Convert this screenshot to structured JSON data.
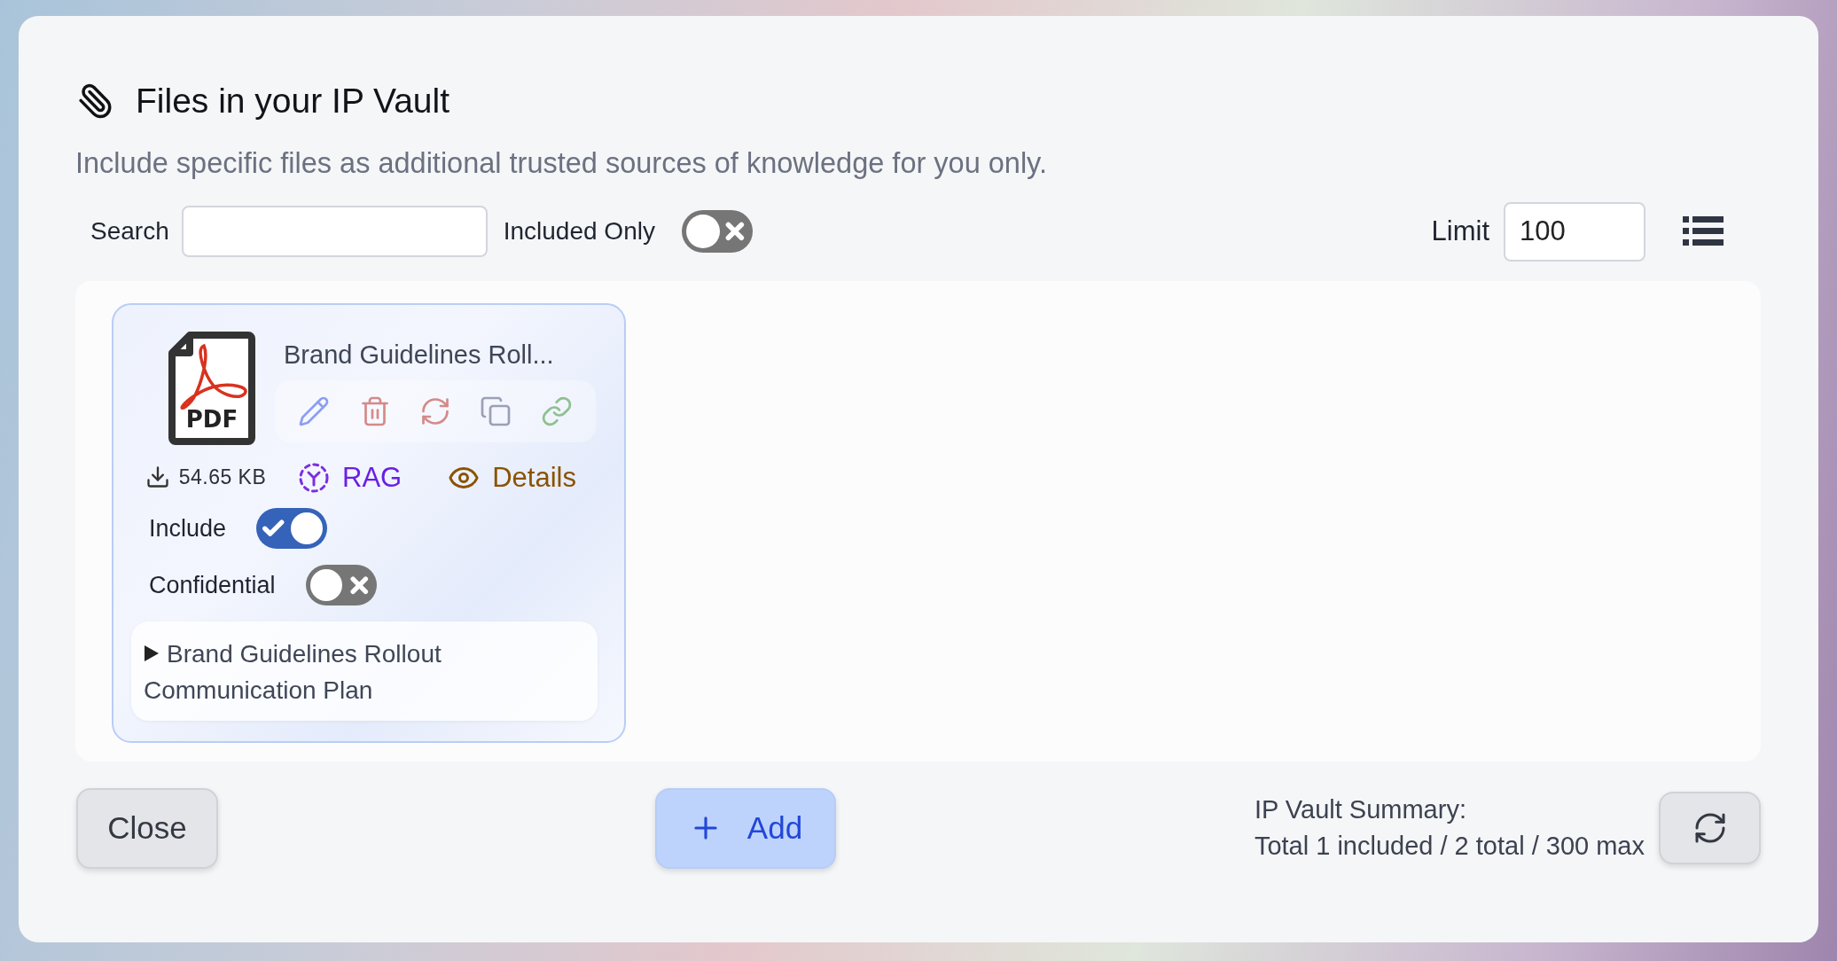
{
  "dialog": {
    "title": "Files in your IP Vault",
    "description": "Include specific files as additional trusted sources of knowledge for you only.",
    "filters": {
      "search": {
        "label": "Search"
      },
      "included_only": {
        "label": "Included Only",
        "on": false
      },
      "limit": {
        "label": "Limit",
        "value": "100"
      }
    },
    "files": [
      {
        "name": "Brand Guidelines Roll...",
        "file_type": "PDF",
        "rag_label": "RAG",
        "details_label": "Details",
        "size": "54.65 KB",
        "include": {
          "label": "Include",
          "on": true
        },
        "confidential": {
          "label": "Confidential",
          "on": false
        },
        "summary": {
          "title": "Brand Guidelines Rollout Communication Plan",
          "expanded": false
        }
      }
    ],
    "footer": {
      "close": "Close",
      "add": "Add",
      "summary_lines": [
        "IP Vault Summary:",
        "Total 1 included / 2 total / 300 max"
      ]
    }
  }
}
